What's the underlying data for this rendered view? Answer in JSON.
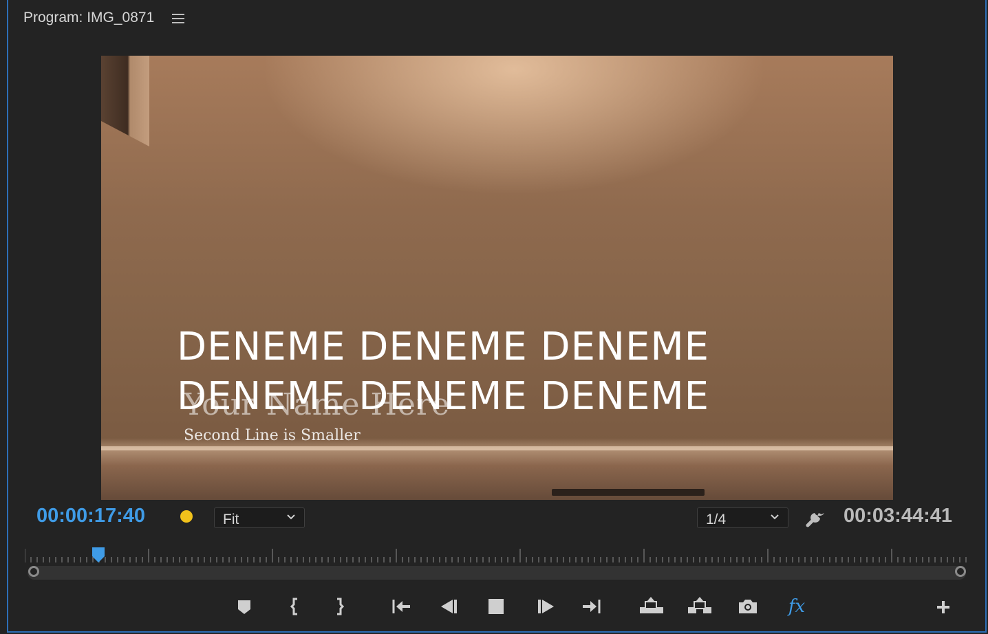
{
  "panel": {
    "title": "Program: IMG_0871"
  },
  "monitor": {
    "caption_line_1": "DENEME DENEME DENEME",
    "caption_line_2": "DENEME DENEME DENEME",
    "overlay_title": "Your Name Here",
    "overlay_subtitle": "Second Line is Smaller"
  },
  "controls": {
    "current_timecode": "00:00:17:40",
    "zoom_value": "Fit",
    "resolution_value": "1/4",
    "duration_timecode": "00:03:44:41",
    "playhead_position": 0.078
  },
  "colors": {
    "accent": "#3f9be6",
    "marker_dot": "#f1c21b"
  },
  "transport_icons": [
    "add-marker-icon",
    "mark-in-icon",
    "mark-out-icon",
    "go-to-in-icon",
    "step-back-icon",
    "stop-icon",
    "step-forward-icon",
    "go-to-out-icon",
    "lift-icon",
    "extract-icon",
    "export-frame-icon",
    "fx-icon",
    "add-button-icon"
  ]
}
